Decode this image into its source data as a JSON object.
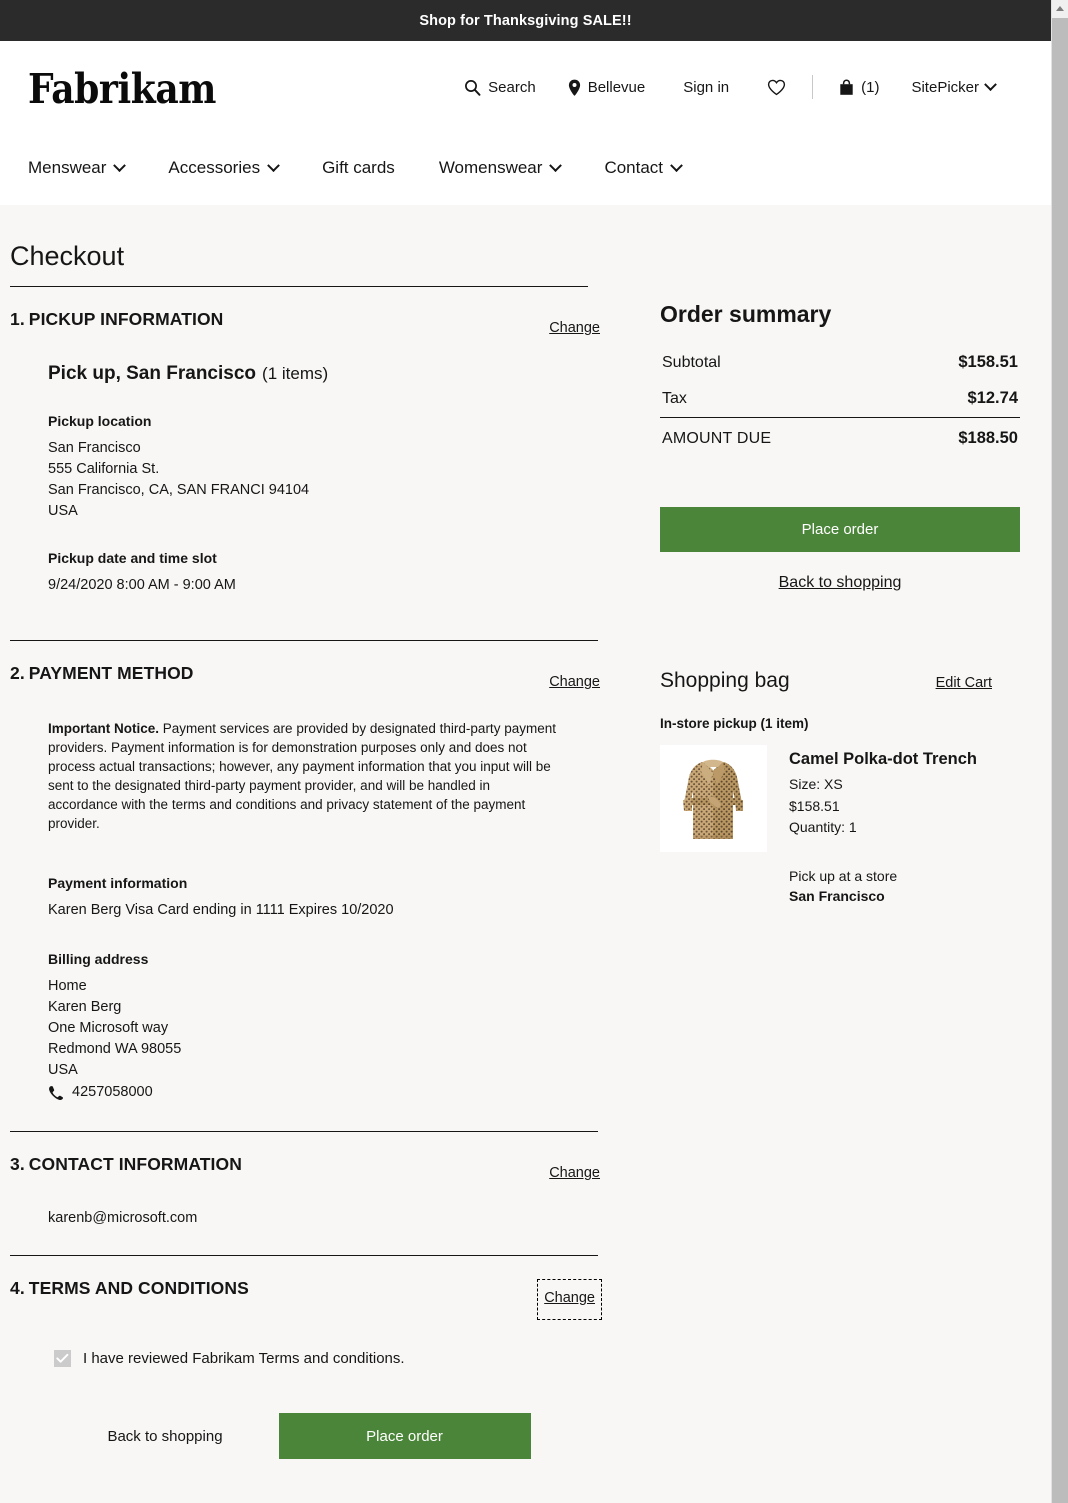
{
  "promo": {
    "text": "Shop for Thanksgiving SALE!!"
  },
  "header": {
    "brand": "Fabrikam",
    "utils": {
      "search_label": "Search",
      "location_label": "Bellevue",
      "sign_in_label": "Sign in",
      "cart_count": "(1)",
      "site_picker_label": "SitePicker"
    },
    "nav": [
      {
        "label": "Menswear",
        "has_chevron": true
      },
      {
        "label": "Accessories",
        "has_chevron": true
      },
      {
        "label": "Gift cards",
        "has_chevron": false
      },
      {
        "label": "Womenswear",
        "has_chevron": true
      },
      {
        "label": "Contact",
        "has_chevron": true
      }
    ]
  },
  "page": {
    "title": "Checkout"
  },
  "sections": {
    "pickup": {
      "number": "1.",
      "title": "PICKUP INFORMATION",
      "change_label": "Change",
      "heading": "Pick up, San Francisco",
      "item_count": "(1 items)",
      "location_label": "Pickup location",
      "address": [
        "San Francisco",
        "555 California St.",
        "San Francisco, CA, SAN FRANCI 94104",
        "USA"
      ],
      "slot_label": "Pickup date and time slot",
      "slot_value": "9/24/2020 8:00 AM - 9:00 AM"
    },
    "payment": {
      "number": "2.",
      "title": "PAYMENT METHOD",
      "change_label": "Change",
      "notice_bold": "Important Notice.",
      "notice_text": " Payment services are provided by designated third-party payment providers.  Payment information is for demonstration purposes only and does not process actual transactions; however, any payment information that you input will be sent to the designated third-party payment provider, and will be handled in accordance with the terms and conditions and privacy statement of the payment provider.",
      "info_label": "Payment information",
      "card_line": "Karen Berg   Visa   Card ending in 1111   Expires 10/2020",
      "billing_label": "Billing address",
      "billing_address": [
        "Home",
        "Karen Berg",
        "One Microsoft way",
        "Redmond WA  98055",
        "USA"
      ],
      "phone": "4257058000"
    },
    "contact": {
      "number": "3.",
      "title": "CONTACT INFORMATION",
      "change_label": "Change",
      "email": "karenb@microsoft.com"
    },
    "terms": {
      "number": "4.",
      "title": "TERMS AND CONDITIONS",
      "change_label": "Change",
      "checkbox_label": "I have reviewed Fabrikam Terms and conditions.",
      "checkbox_checked": true,
      "back_label": "Back to shopping",
      "place_order_label": "Place order"
    }
  },
  "order_summary": {
    "title": "Order summary",
    "rows": [
      {
        "label": "Subtotal",
        "amount": "$158.51"
      },
      {
        "label": "Tax",
        "amount": "$12.74"
      }
    ],
    "total_label": "AMOUNT DUE",
    "total_amount": "$188.50",
    "place_order_label": "Place order",
    "back_label": "Back to shopping"
  },
  "shopping_bag": {
    "title": "Shopping bag",
    "edit_label": "Edit Cart",
    "group_label": "In-store pickup (1 item)",
    "item": {
      "name": "Camel Polka-dot Trench",
      "size": "Size: XS",
      "price": "$158.51",
      "quantity": "Quantity: 1",
      "pickup_label": "Pick up at a store",
      "store": "San Francisco"
    }
  },
  "colors": {
    "banner_bg": "#2b2b2b",
    "page_bg": "#f8f7f5",
    "accent_green": "#4a8539",
    "text": "#161616",
    "scrollbar_thumb": "#bcbcbc"
  }
}
